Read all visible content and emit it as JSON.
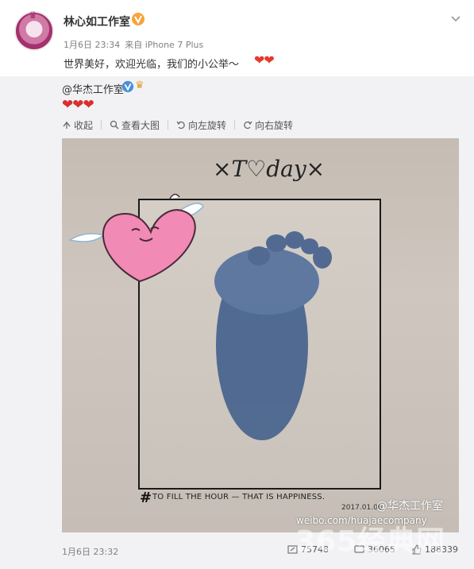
{
  "user": {
    "name": "林心如工作室"
  },
  "post": {
    "meta_date": "1月6日 23:34",
    "meta_source": "来自 iPhone 7 Plus",
    "text": "世界美好，欢迎光临，我们的小公举～",
    "emoji": "❤❤"
  },
  "repost": {
    "author": "@华杰工作室",
    "hearts": "❤❤❤",
    "tools": [
      {
        "label": "收起"
      },
      {
        "label": "查看大图"
      },
      {
        "label": "向左旋转"
      },
      {
        "label": "向右旋转"
      }
    ],
    "photo": {
      "handwriting": "×T♡day×",
      "caption": "TO FILL THE HOUR — THAT IS HAPPINESS.",
      "caption_hash": "#",
      "date_stamp": "2017.01.06",
      "watermark_handle": "@华杰工作室",
      "watermark_url": "weibo.com/huajaecompany",
      "site_watermark": "365经典网"
    },
    "footer": {
      "time": "1月6日 23:32",
      "forward_count": "75748",
      "comment_count": "36065",
      "like_count": "188339"
    }
  },
  "colors": {
    "accent": "#eb7350",
    "verified": "#f6a43c",
    "heart": "#e0302a",
    "meta": "#808080"
  }
}
